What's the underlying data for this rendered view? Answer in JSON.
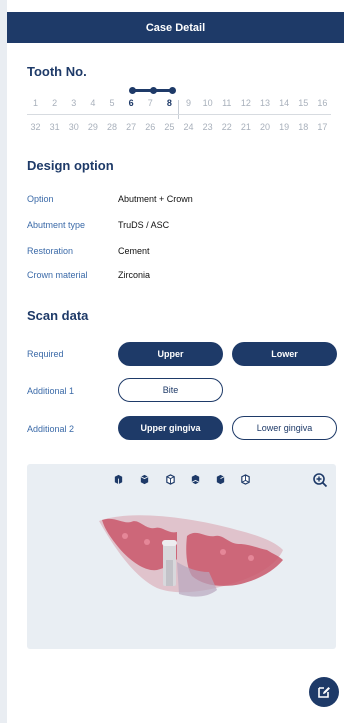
{
  "header": {
    "title": "Case Detail"
  },
  "tooth": {
    "title": "Tooth No.",
    "upper": [
      "1",
      "2",
      "3",
      "4",
      "5",
      "6",
      "7",
      "8",
      "9",
      "10",
      "11",
      "12",
      "13",
      "14",
      "15",
      "16"
    ],
    "lower": [
      "32",
      "31",
      "30",
      "29",
      "28",
      "27",
      "26",
      "25",
      "24",
      "23",
      "22",
      "21",
      "20",
      "19",
      "18",
      "17"
    ],
    "selected_upper": [
      "6",
      "8"
    ],
    "bridge": [
      "6",
      "7",
      "8"
    ]
  },
  "design": {
    "title": "Design option",
    "rows": [
      {
        "label": "Option",
        "value": "Abutment + Crown"
      },
      {
        "label": "Abutment type",
        "value": "TruDS / ASC"
      },
      {
        "label": "Restoration",
        "value": "Cement"
      },
      {
        "label": "Crown material",
        "value": "Zirconia"
      }
    ]
  },
  "scan": {
    "title": "Scan data",
    "required_label": "Required",
    "upper": "Upper",
    "lower": "Lower",
    "additional1_label": "Additional 1",
    "bite": "Bite",
    "additional2_label": "Additional 2",
    "upper_gingiva": "Upper gingiva",
    "lower_gingiva": "Lower gingiva"
  },
  "viewer": {
    "view_icons": [
      "view-front-icon",
      "view-left-icon",
      "view-top-icon",
      "view-bottom-icon",
      "view-right-icon",
      "view-back-icon"
    ],
    "colors": {
      "model": "#c9576a",
      "background": "#e9eef3"
    }
  },
  "colors": {
    "primary": "#1e3a68",
    "label": "#3b6aa8"
  }
}
